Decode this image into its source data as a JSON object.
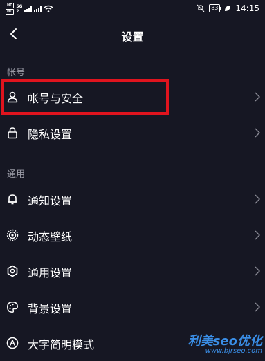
{
  "status_bar": {
    "hd1": "HD",
    "hd2": "HD",
    "net1": "5G",
    "net2": "2",
    "battery": "83",
    "time": "14:15"
  },
  "nav": {
    "title": "设置"
  },
  "sections": {
    "account": {
      "header": "帐号",
      "items": [
        {
          "label": "帐号与安全",
          "icon": "user-icon"
        },
        {
          "label": "隐私设置",
          "icon": "lock-icon"
        }
      ]
    },
    "general": {
      "header": "通用",
      "items": [
        {
          "label": "通知设置",
          "icon": "bell-icon"
        },
        {
          "label": "动态壁纸",
          "icon": "dynamic-wallpaper-icon"
        },
        {
          "label": "通用设置",
          "icon": "gear-icon"
        },
        {
          "label": "背景设置",
          "icon": "palette-icon"
        },
        {
          "label": "大字简明模式",
          "icon": "large-font-icon"
        }
      ]
    }
  },
  "watermark": {
    "main": "利美seo优化",
    "sub": "www.bjrseo.com"
  },
  "colors": {
    "background": "#161723",
    "highlight": "#e0141e",
    "section_text": "#9a9ba6"
  }
}
